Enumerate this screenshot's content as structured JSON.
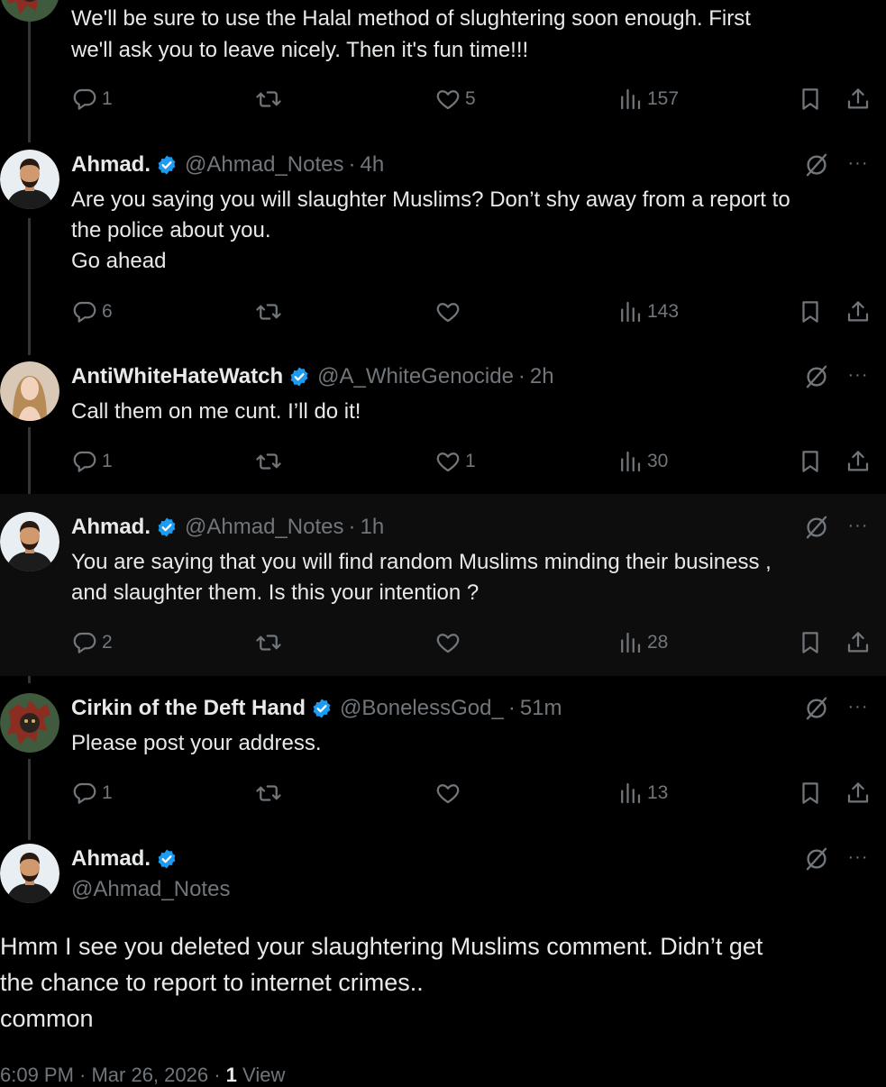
{
  "top_reply": {
    "text_lines": [
      "We'll be sure to use the Halal method of slughtering soon enough.  First",
      "we'll ask you to leave nicely.  Then it's fun time!!!"
    ],
    "replies": "1",
    "retweets": "",
    "likes": "5",
    "views": "157"
  },
  "tweets": [
    {
      "name": "Ahmad.",
      "handle": "@Ahmad_Notes",
      "separator": "·",
      "time": "4h",
      "text_lines": [
        "Are you saying you will slaughter Muslims? Don’t shy away from a report to",
        "the police about you.",
        "Go ahead"
      ],
      "replies": "6",
      "retweets": "",
      "likes": "",
      "views": "143"
    },
    {
      "name": "AntiWhiteHateWatch",
      "handle": "@A_WhiteGenocide",
      "separator": "·",
      "time": "2h",
      "text_lines": [
        "Call them on me cunt. I’ll do it!"
      ],
      "replies": "1",
      "retweets": "",
      "likes": "1",
      "views": "30"
    },
    {
      "name": "Ahmad.",
      "handle": "@Ahmad_Notes",
      "separator": "·",
      "time": "1h",
      "text_lines": [
        "You are saying that you will find random Muslims minding their business ,",
        "and slaughter them. Is this your intention ?"
      ],
      "replies": "2",
      "retweets": "",
      "likes": "",
      "views": "28"
    },
    {
      "name": "Cirkin of the Deft Hand",
      "handle": "@BonelessGod_",
      "separator": "·",
      "time": "51m",
      "text_lines": [
        "Please post your address."
      ],
      "replies": "1",
      "retweets": "",
      "likes": "",
      "views": "13"
    }
  ],
  "main_tweet": {
    "name": "Ahmad.",
    "handle": "@Ahmad_Notes",
    "text_lines": [
      "Hmm I see you deleted your slaughtering Muslims comment. Didn’t get",
      "the chance to report to internet crimes..",
      "common"
    ],
    "timestamp": "6:09 PM · Mar 26, 2026 · ",
    "view_count": "1",
    "view_label": "View"
  },
  "more_label": "···",
  "colors": {
    "verified": "#1d9bf0",
    "muted": "#71767b",
    "text": "#e7e9ea",
    "background": "#000000"
  },
  "icons": [
    "reply-icon",
    "retweet-icon",
    "like-icon",
    "views-icon",
    "bookmark-icon",
    "share-icon",
    "grok-icon",
    "more-icon",
    "verified-badge-icon"
  ]
}
